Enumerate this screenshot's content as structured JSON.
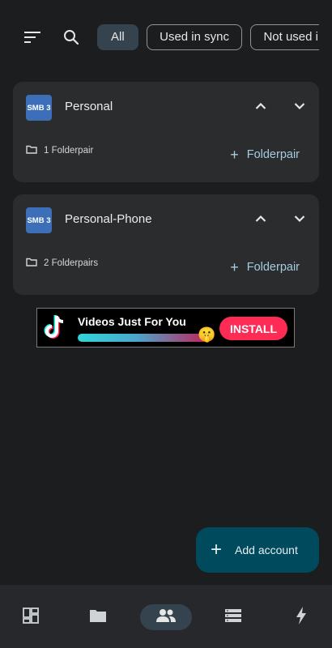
{
  "toolbar": {
    "sort_icon": "sort-icon",
    "search_icon": "search-icon"
  },
  "filters": [
    {
      "label": "All",
      "active": true
    },
    {
      "label": "Used in sync",
      "active": false
    },
    {
      "label": "Not used in s",
      "active": false
    }
  ],
  "accounts": [
    {
      "badge": "SMB 3",
      "name": "Personal",
      "folderpairs": "1 Folderpair",
      "add_label": "Folderpair"
    },
    {
      "badge": "SMB 3",
      "name": "Personal-Phone",
      "folderpairs": "2 Folderpairs",
      "add_label": "Folderpair"
    }
  ],
  "ad": {
    "title": "Videos Just For You",
    "install_label": "INSTALL",
    "logo": "tiktok-logo-icon",
    "emoji": "🤫"
  },
  "fab": {
    "label": "Add account"
  },
  "bottom_nav": [
    {
      "icon": "dashboard-icon",
      "active": false
    },
    {
      "icon": "folder-icon",
      "active": false
    },
    {
      "icon": "accounts-icon",
      "active": true
    },
    {
      "icon": "list-icon",
      "active": false
    },
    {
      "icon": "bolt-icon",
      "active": false
    }
  ],
  "colors": {
    "background": "#1b1d1f",
    "card": "#2a2c2e",
    "accent": "#a6cce0",
    "badge": "#3c6fb8",
    "fab": "#004a5e",
    "chip_active": "#34434e"
  }
}
